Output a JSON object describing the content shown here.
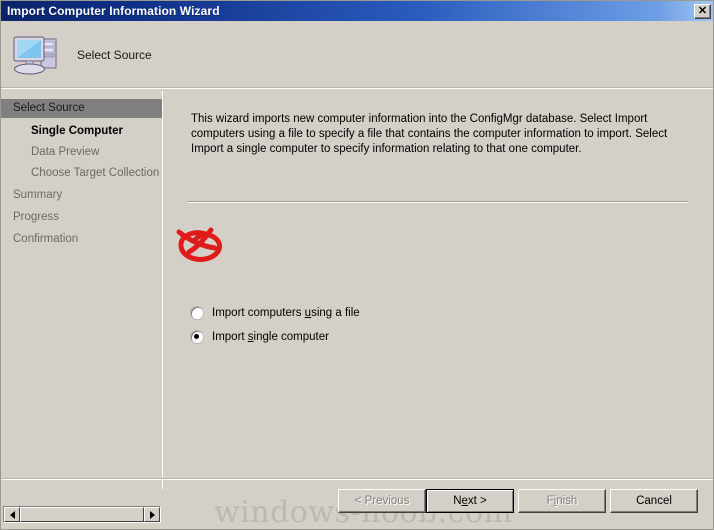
{
  "window": {
    "title": "Import Computer Information Wizard",
    "close_label": "✕"
  },
  "header": {
    "icon": "computer-icon",
    "title": "Select Source"
  },
  "sidebar": {
    "items": [
      {
        "label": "Select Source",
        "state": "selected"
      },
      {
        "label": "Single Computer",
        "state": "current"
      },
      {
        "label": "Data Preview",
        "state": "pending"
      },
      {
        "label": "Choose Target Collection",
        "state": "pending"
      },
      {
        "label": "Summary",
        "state": "pending"
      },
      {
        "label": "Progress",
        "state": "pending"
      },
      {
        "label": "Confirmation",
        "state": "pending"
      }
    ]
  },
  "main": {
    "description": "This wizard imports new computer information into the ConfigMgr database. Select Import computers using a file to specify a file that contains the computer information to import. Select Import a single computer to specify information relating to that one computer.",
    "options": [
      {
        "id": "import-using-file",
        "pre": "Import computers ",
        "accel": "u",
        "post": "sing a file",
        "selected": false
      },
      {
        "id": "import-single-computer",
        "pre": "Import ",
        "accel": "s",
        "post": "ingle computer",
        "selected": true
      }
    ]
  },
  "buttons": {
    "previous": "< Previous",
    "next_pre": "N",
    "next_accel": "e",
    "next_post": "xt >",
    "finish_pre": "F",
    "finish_accel": "i",
    "finish_post": "nish",
    "cancel": "Cancel"
  },
  "watermark": "windows-noob.com",
  "colors": {
    "titlebar_start": "#0a246a",
    "titlebar_end": "#a6c8f0",
    "face": "#d4d0c8",
    "selected_nav": "#808080",
    "annotation": "#e01b1b"
  }
}
